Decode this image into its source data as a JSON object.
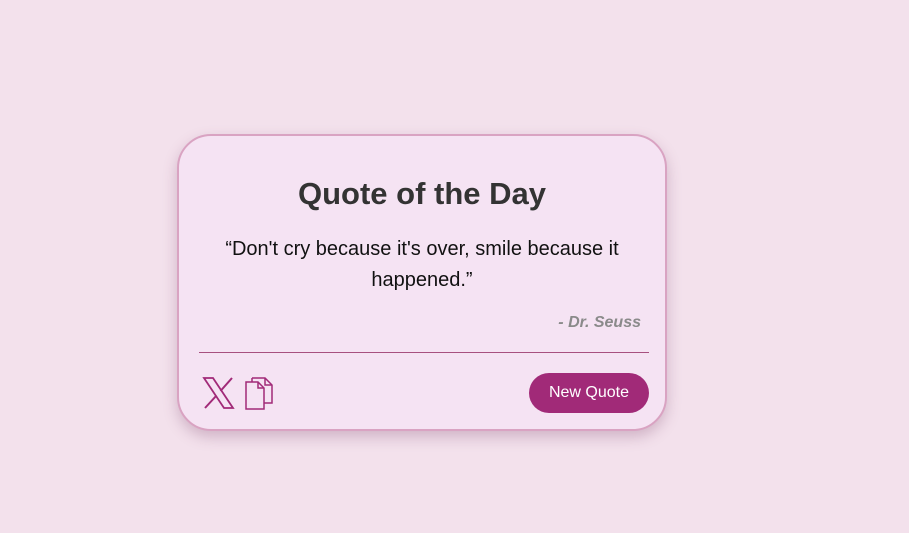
{
  "card": {
    "title": "Quote of the Day",
    "quote": "“Don't cry because it's over, smile because it happened.”",
    "author": "- Dr. Seuss"
  },
  "actions": {
    "share_icon": "x-twitter-icon",
    "copy_icon": "copy-icon",
    "new_quote_label": "New Quote"
  },
  "colors": {
    "background": "#f3e1ec",
    "card": "#f5e3f3",
    "accent": "#a12a78",
    "border": "#d9a3c2"
  }
}
